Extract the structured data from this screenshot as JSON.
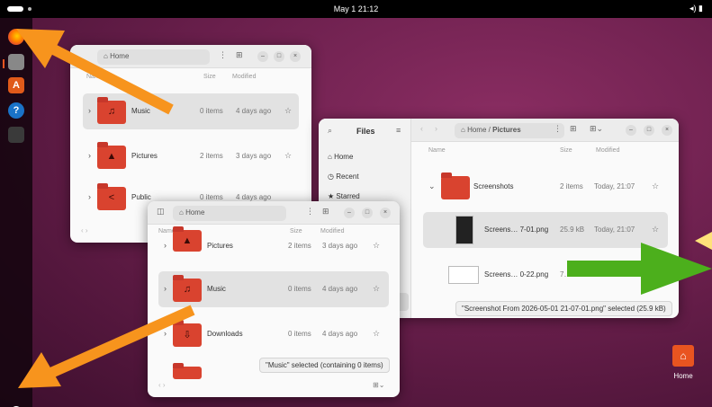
{
  "topbar": {
    "clock": "May 1  21:12",
    "tray": "◂) ▮"
  },
  "dock": [
    "firefox",
    "files",
    "app-center",
    "help",
    "trash"
  ],
  "desktop_icon": {
    "label": "Home",
    "icon": "home-icon"
  },
  "win_home": {
    "path": "Home",
    "headers": {
      "name": "Name",
      "size": "Size",
      "modified": "Modified"
    },
    "rows": [
      {
        "name": "Music",
        "size": "0 items",
        "modified": "4 days ago",
        "icon": "music-note-icon"
      },
      {
        "name": "Pictures",
        "size": "2 items",
        "modified": "3 days ago",
        "icon": "image-icon"
      },
      {
        "name": "Public",
        "size": "0 items",
        "modified": "4 days ago",
        "icon": "share-icon"
      }
    ]
  },
  "win_pictures": {
    "sidebar_title": "Files",
    "sidebar": [
      "Home",
      "Recent",
      "Starred"
    ],
    "breadcrumb": {
      "root": "Home",
      "sep": "/",
      "current": "Pictures"
    },
    "headers": {
      "name": "Name",
      "size": "Size",
      "modified": "Modified"
    },
    "rows": [
      {
        "name": "Screenshots",
        "size": "2 items",
        "modified": "Today, 21:07"
      },
      {
        "name": "Screens… 7-01.png",
        "size": "25.9 kB",
        "modified": "Today, 21:07"
      },
      {
        "name": "Screens… 0-22.png",
        "size": "7…",
        "modified": ""
      }
    ],
    "status": "\"Screenshot From 2026-05-01 21-07-01.png\" selected  (25.9 kB)"
  },
  "win_front": {
    "path": "Home",
    "headers": {
      "name": "Name",
      "size": "Size",
      "modified": "Modified"
    },
    "rows": [
      {
        "name": "Pictures",
        "size": "2 items",
        "modified": "3 days ago",
        "icon": "image-icon"
      },
      {
        "name": "Music",
        "size": "0 items",
        "modified": "4 days ago",
        "icon": "music-note-icon"
      },
      {
        "name": "Downloads",
        "size": "0 items",
        "modified": "4 days ago",
        "icon": "download-icon"
      }
    ],
    "status": "\"Music\" selected  (containing 0 items)"
  },
  "colors": {
    "accent": "#e95420",
    "folder": "#d9432f",
    "arrow_orange": "#f7941d",
    "arrow_green": "#4caf1c"
  }
}
